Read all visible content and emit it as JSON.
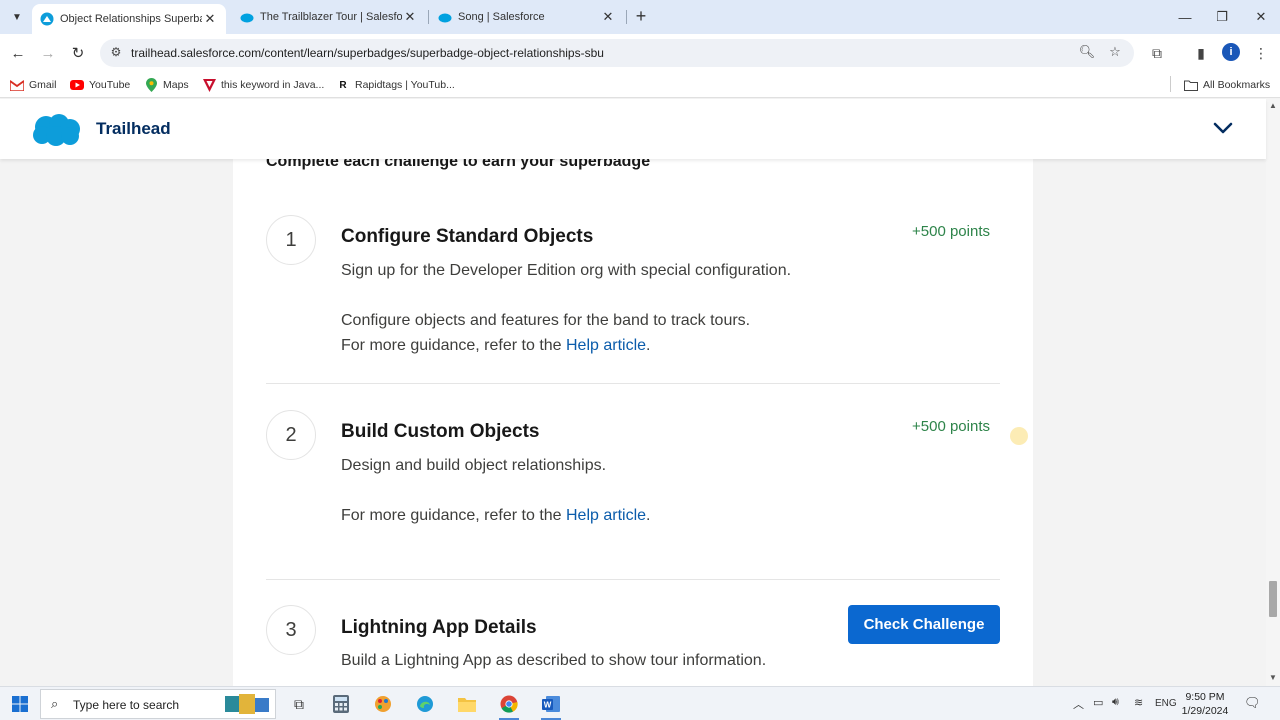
{
  "browser": {
    "tabs": [
      {
        "title": "Object Relationships Superbadge",
        "active": true
      },
      {
        "title": "The Trailblazer Tour | Salesforce",
        "active": false
      },
      {
        "title": "Song | Salesforce",
        "active": false
      }
    ],
    "url": "trailhead.salesforce.com/content/learn/superbadges/superbadge-object-relationships-sbu",
    "bookmarks": [
      "Gmail",
      "YouTube",
      "Maps",
      "this keyword in Java...",
      "Rapidtags | YouTub..."
    ],
    "all_bookmarks_label": "All Bookmarks",
    "profile_initial": "i"
  },
  "site": {
    "logo_text": "Trailhead"
  },
  "main": {
    "heading": "Complete each challenge to earn your superbadge",
    "challenges": [
      {
        "number": "1",
        "title": "Configure Standard Objects",
        "points": "+500 points",
        "line1": "Sign up for the Developer Edition org with special configuration.",
        "line2": "Configure objects and features for the band to track tours.",
        "guidance_prefix": "For more guidance, refer to the ",
        "link": "Help article",
        "guidance_suffix": "."
      },
      {
        "number": "2",
        "title": "Build Custom Objects",
        "points": "+500 points",
        "line1": "Design and build object relationships.",
        "guidance_prefix": "For more guidance, refer to the ",
        "link": "Help article",
        "guidance_suffix": "."
      },
      {
        "number": "3",
        "title": "Lightning App Details",
        "button": "Check Challenge",
        "line1": "Build a Lightning App as described to show tour information."
      }
    ]
  },
  "taskbar": {
    "search_placeholder": "Type here to search",
    "language": "ENG",
    "time": "9:50 PM",
    "date": "1/29/2024"
  },
  "colors": {
    "accent": "#0b68d0",
    "points": "#2e844a",
    "link": "#0b5cab",
    "brand_navy": "#032d60"
  }
}
